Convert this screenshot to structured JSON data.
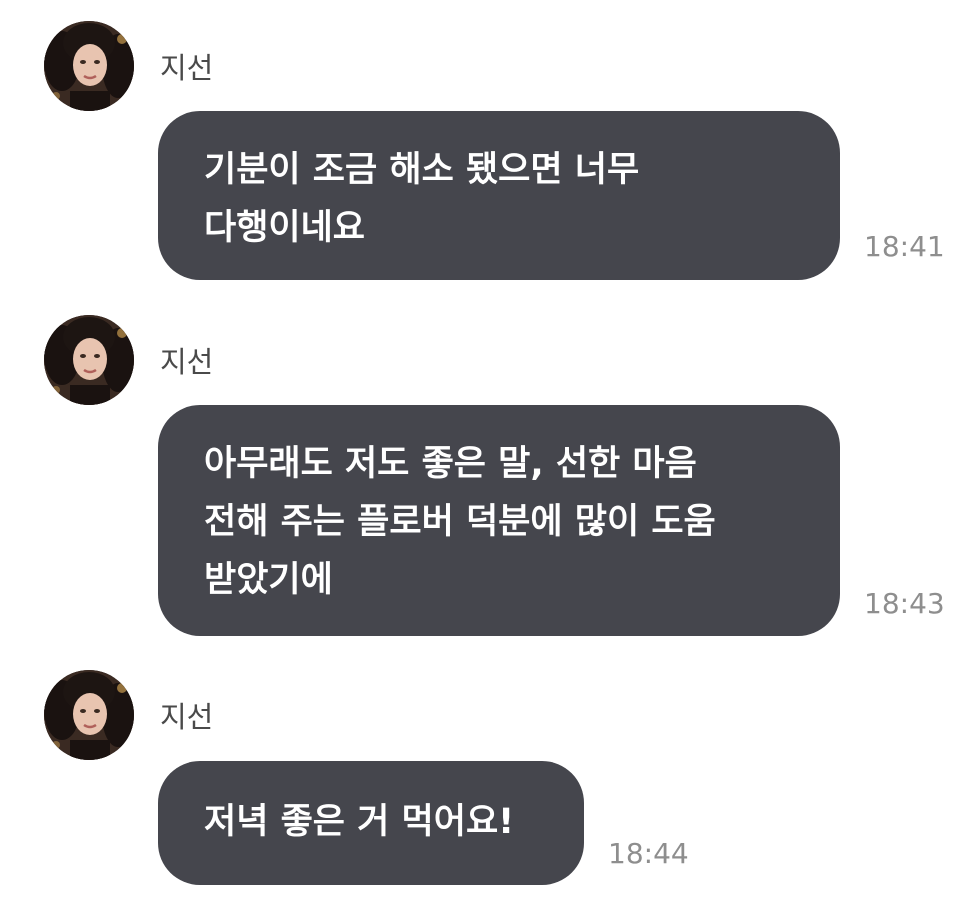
{
  "messages": [
    {
      "sender": "지선",
      "avatar_icon": "profile-photo",
      "text": "기분이 조금 해소 됐으면 너무\n다행이네요",
      "time": "18:41"
    },
    {
      "sender": "지선",
      "avatar_icon": "profile-photo",
      "text": "아무래도 저도 좋은 말, 선한 마음\n전해 주는 플로버 덕분에 많이 도움\n받았기에",
      "time": "18:43"
    },
    {
      "sender": "지선",
      "avatar_icon": "profile-photo",
      "text": "저녁 좋은 거 먹어요!",
      "time": "18:44"
    }
  ],
  "colors": {
    "bubble": "#45464d",
    "bubble_text": "#ffffff",
    "sender_text": "#4a4a4a",
    "time_text": "#8e8e8e"
  }
}
